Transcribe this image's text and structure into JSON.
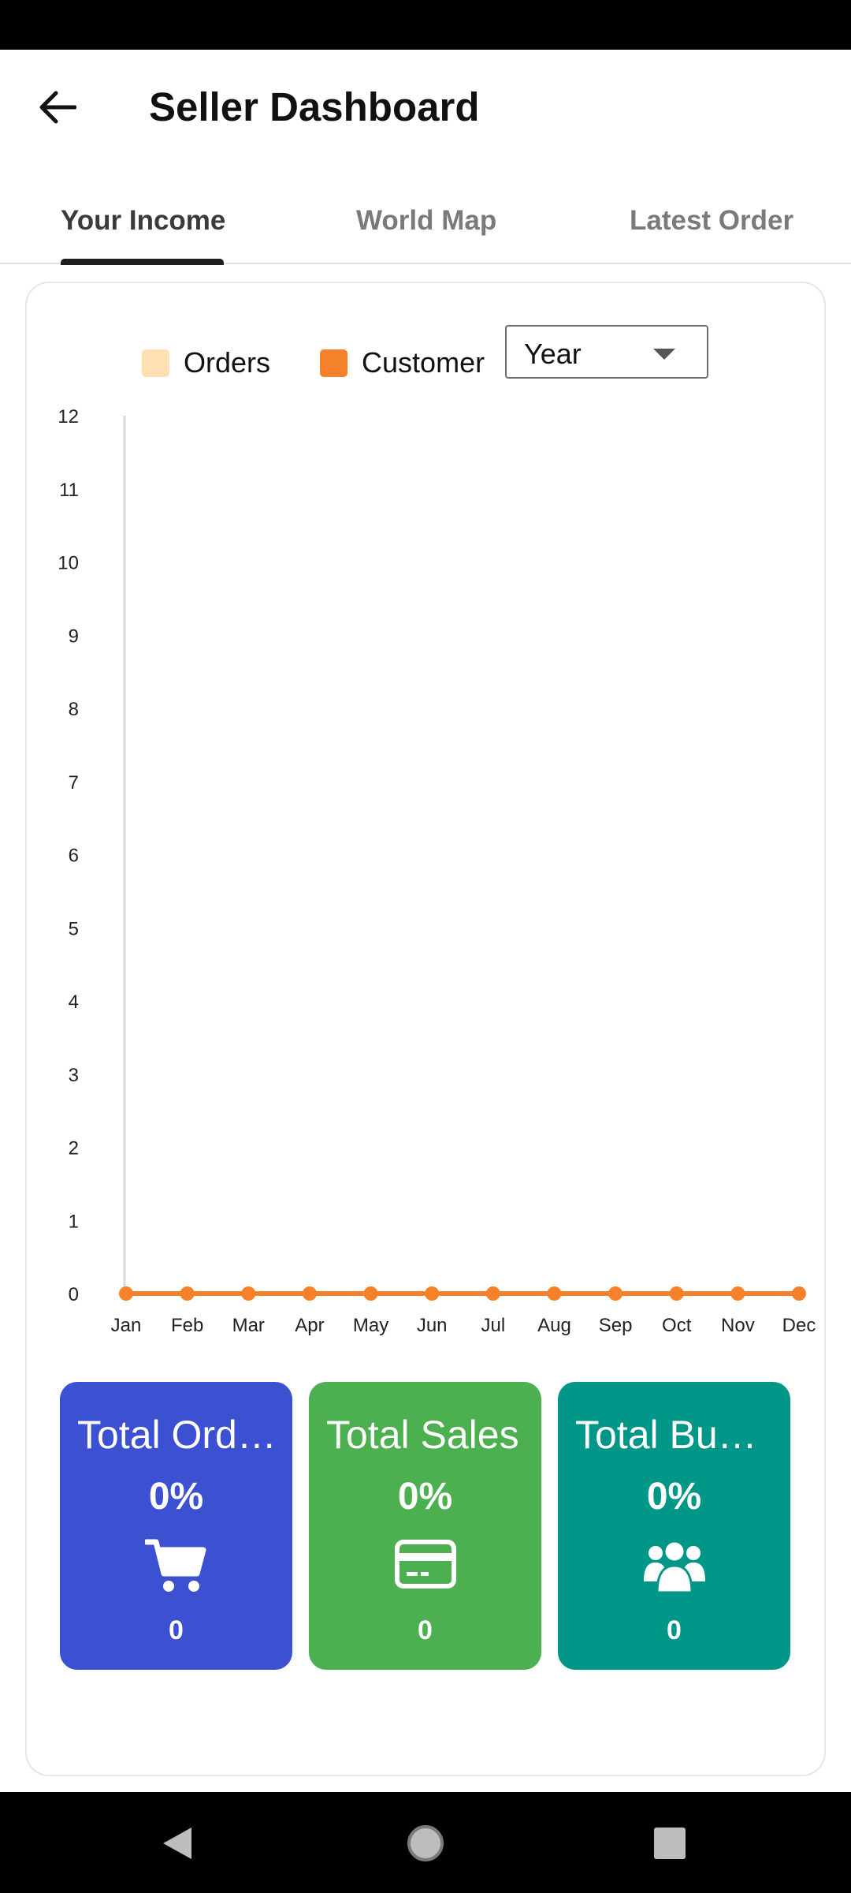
{
  "header": {
    "title": "Seller Dashboard"
  },
  "tabs": [
    {
      "label": "Your Income",
      "active": true
    },
    {
      "label": "World Map",
      "active": false
    },
    {
      "label": "Latest Order",
      "active": false
    }
  ],
  "filter": {
    "selected": "Year"
  },
  "legend": [
    {
      "label": "Orders",
      "color": "#FFE0B2"
    },
    {
      "label": "Customer",
      "color": "#F5822A"
    }
  ],
  "chart_data": {
    "type": "line",
    "categories": [
      "Jan",
      "Feb",
      "Mar",
      "Apr",
      "May",
      "Jun",
      "Jul",
      "Aug",
      "Sep",
      "Oct",
      "Nov",
      "Dec"
    ],
    "series": [
      {
        "name": "Orders",
        "color": "#FFE0B2",
        "values": [
          0,
          0,
          0,
          0,
          0,
          0,
          0,
          0,
          0,
          0,
          0,
          0
        ]
      },
      {
        "name": "Customer",
        "color": "#F5822A",
        "values": [
          0,
          0,
          0,
          0,
          0,
          0,
          0,
          0,
          0,
          0,
          0,
          0
        ]
      }
    ],
    "yticks": [
      "0",
      "1",
      "2",
      "3",
      "4",
      "5",
      "6",
      "7",
      "8",
      "9",
      "10",
      "11",
      "12"
    ],
    "ylim": [
      0,
      12
    ],
    "grid": false,
    "legend_position": "top"
  },
  "stats": [
    {
      "title": "Total Orders",
      "percent": "0%",
      "count": "0",
      "icon": "cart-icon",
      "color": "#3B51D1"
    },
    {
      "title": "Total Sales",
      "percent": "0%",
      "count": "0",
      "icon": "credit-card-icon",
      "color": "#4CAF50"
    },
    {
      "title": "Total Buyers",
      "percent": "0%",
      "count": "0",
      "icon": "users-icon",
      "color": "#009688"
    }
  ]
}
